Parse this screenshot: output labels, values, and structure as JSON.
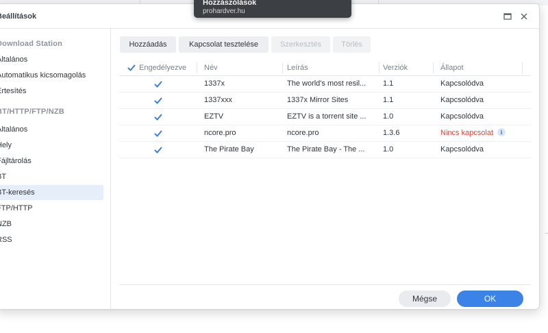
{
  "dialog": {
    "title": "Beállítások"
  },
  "toast": {
    "title": "Hozzászólások",
    "subtitle": "prohardver.hu"
  },
  "sidebar": {
    "items": [
      {
        "label": "Download Station",
        "type": "header"
      },
      {
        "label": "Általános",
        "type": "item"
      },
      {
        "label": "Automatikus kicsomagolás",
        "type": "item"
      },
      {
        "label": "Értesítés",
        "type": "item"
      },
      {
        "label": "BT/HTTP/FTP/NZB",
        "type": "header"
      },
      {
        "label": "Általános",
        "type": "item"
      },
      {
        "label": "Hely",
        "type": "item"
      },
      {
        "label": "Fájltárolás",
        "type": "item"
      },
      {
        "label": "BT",
        "type": "item"
      },
      {
        "label": "BT-keresés",
        "type": "item",
        "active": true
      },
      {
        "label": "FTP/HTTP",
        "type": "item"
      },
      {
        "label": "NZB",
        "type": "item"
      },
      {
        "label": "RSS",
        "type": "item"
      }
    ]
  },
  "toolbar": {
    "add": "Hozzáadás",
    "test": "Kapcsolat tesztelése",
    "edit": "Szerkesztés",
    "delete": "Törlés"
  },
  "table": {
    "headers": {
      "enabled": "Engedélyezve",
      "name": "Név",
      "description": "Leírás",
      "version": "Verziók",
      "status": "Állapot"
    },
    "rows": [
      {
        "enabled": true,
        "name": "1337x",
        "description": "The world's most resil...",
        "version": "1.1",
        "status": "Kapcsolódva",
        "error": false
      },
      {
        "enabled": true,
        "name": "1337xxx",
        "description": "1337x Mirror Sites",
        "version": "1.1",
        "status": "Kapcsolódva",
        "error": false
      },
      {
        "enabled": true,
        "name": "EZTV",
        "description": "EZTV is a torrent site ...",
        "version": "1.0",
        "status": "Kapcsolódva",
        "error": false
      },
      {
        "enabled": true,
        "name": "ncore.pro",
        "description": "ncore.pro",
        "version": "1.3.6",
        "status": "Nincs kapcsolat",
        "error": true
      },
      {
        "enabled": true,
        "name": "The Pirate Bay",
        "description": "The Pirate Bay - The ...",
        "version": "1.0",
        "status": "Kapcsolódva",
        "error": false
      }
    ]
  },
  "footer": {
    "cancel": "Mégse",
    "ok": "OK"
  },
  "icons": {
    "maximize": "maximize-icon",
    "close": "close-icon",
    "checkbox": "checkmark-icon",
    "info": "info-icon"
  },
  "colors": {
    "accent": "#3b83e6",
    "checkmark": "#3e7dd6",
    "error": "#e0443b",
    "active_item": "#e6eef9"
  }
}
